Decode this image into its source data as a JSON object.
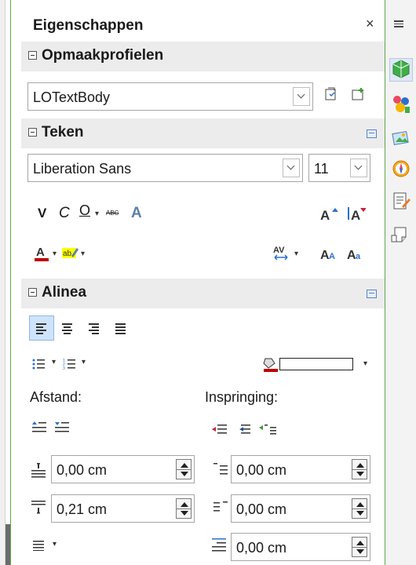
{
  "panel": {
    "title": "Eigenschappen",
    "close_label": "×"
  },
  "styles_section": {
    "title": "Opmaakprofielen",
    "paragraph_style_value": "LOTextBody"
  },
  "character_section": {
    "title": "Teken",
    "font_name_value": "Liberation Sans",
    "font_size_value": "11",
    "bold_label": "V",
    "italic_label": "C",
    "underline_label": "O",
    "strike_label": "ABC",
    "shadow_label": "A",
    "grow_label": "A",
    "shrink_label": "A",
    "font_color_label": "A",
    "highlight_label": "ab",
    "spacing_label": "AV",
    "upper_label": "AA",
    "lower_label": "Aa"
  },
  "paragraph_section": {
    "title": "Alinea",
    "spacing_label": "Afstand:",
    "indent_label": "Inspringing:",
    "above_value": "0,00 cm",
    "below_value": "0,21 cm",
    "before_indent_value": "0,00 cm",
    "after_indent_value": "0,00 cm",
    "first_line_value": "0,00 cm"
  },
  "colors": {
    "accent_green": "#5da84a",
    "font_color_red": "#c00000",
    "highlight_yellow": "#ffff00"
  }
}
